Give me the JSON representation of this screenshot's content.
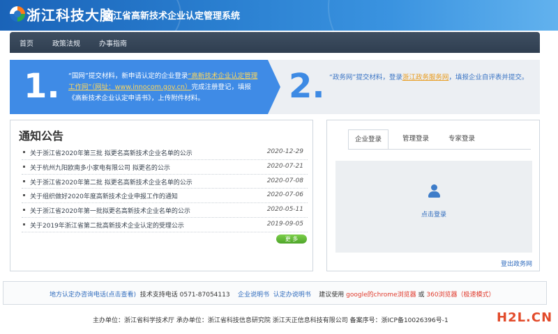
{
  "header": {
    "brand": "浙江科技大脑",
    "system_title": "浙江省高新技术企业认定管理系统"
  },
  "nav": {
    "items": [
      "首页",
      "政策法规",
      "办事指南"
    ]
  },
  "steps": {
    "step1": {
      "num": "1.",
      "text_a": "“国网”提交材料，新申请认定的企业登录",
      "link": "“高新技术企业认定管理工作网”（网址：www.innocom.gov.cn）",
      "text_b": "完成注册登记，填报《高新技术企业认定申请书》，上传附件材料。"
    },
    "step2": {
      "num": "2.",
      "text_a": "“政务网”提交材料，登录",
      "link": "浙江政务服务网",
      "text_b": "，填报企业自评表并提交。"
    }
  },
  "notice": {
    "title": "通知公告",
    "items": [
      {
        "title": "关于浙江省2020年第三批 拟更名高新技术企业名单的公示",
        "date": "2020-12-29"
      },
      {
        "title": "关于杭州九阳欧南多小家电有限公司 拟更名的公示",
        "date": "2020-07-21"
      },
      {
        "title": "关于浙江省2020年第二批 拟更名高新技术企业名单的公示",
        "date": "2020-07-08"
      },
      {
        "title": "关于组织做好2020年度高新技术企业申报工作的通知",
        "date": "2020-07-06"
      },
      {
        "title": "关于浙江省2020年第一批拟更名高新技术企业名单的公示",
        "date": "2020-05-11"
      },
      {
        "title": "关于2019年浙江省第二批高新技术企业认定的受理公示",
        "date": "2019-09-05"
      }
    ],
    "more_label": "更 多"
  },
  "login": {
    "tabs": [
      "企业登录",
      "管理登录",
      "专家登录"
    ],
    "active_tab": "企业登录",
    "click_label": "点击登录",
    "logout_label": "登出政务网"
  },
  "footer": {
    "consult_link": "地方认定办咨询电话(点击查看)",
    "support": "技术支持电话 0571-87054113",
    "manual_1": "企业说明书",
    "manual_2": "认定办说明书",
    "suggest": "建议使用",
    "chrome": "google的chrome浏览器",
    "or": "或",
    "b360": "360浏览器（极速模式）",
    "copyright": "主办单位：浙江省科学技术厅 承办单位：浙江省科技信息研究院 浙江天正信息科技有限公司 备案序号：浙ICP备10026396号-1"
  },
  "watermark": "H2L.CN",
  "colors": {
    "header_blue": "#2a7fd0",
    "step_blue": "#3f8be6",
    "link_orange": "#e89a1a",
    "footer_red": "#e0392b",
    "more_green": "#5bb335"
  }
}
